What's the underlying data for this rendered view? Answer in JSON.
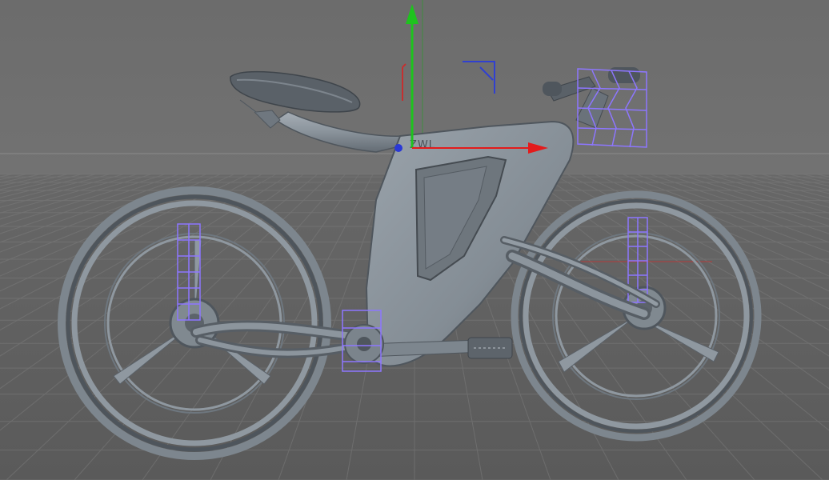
{
  "scene": {
    "frame_label": "ZWL",
    "colors": {
      "background_wall": "#6b6b6b",
      "floor": "#5f5f5f",
      "grid": "#7f7f7f",
      "model_body": "#8e979f",
      "model_dark": "#4f565d",
      "selection": "#8d76ff",
      "axis_x": "#e31b1b",
      "axis_y": "#1ec31e",
      "axis_z": "#2a38d6"
    }
  }
}
